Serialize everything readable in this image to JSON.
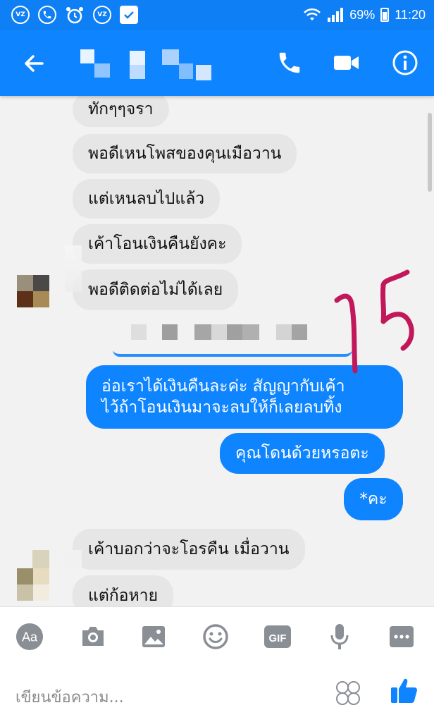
{
  "status_bar": {
    "battery": "69%",
    "time": "11:20",
    "icons": [
      "vpn-icon",
      "phone-icon",
      "alarm-icon",
      "vpn-icon",
      "clipboard-check-icon",
      "wifi-icon",
      "signal-icon",
      "battery-icon"
    ]
  },
  "header": {
    "contact_name_blurred": true,
    "actions": [
      "back-arrow-icon",
      "phone-call-icon",
      "video-call-icon",
      "info-icon"
    ]
  },
  "messages": [
    {
      "side": "in",
      "text": "ทักๆๆจรา"
    },
    {
      "side": "in",
      "text": "พอดีเหนโพสของคุนเมือวาน"
    },
    {
      "side": "in",
      "text": "แต่เหนลบไปแล้ว"
    },
    {
      "side": "in",
      "text": "เค้าโอนเงินคืนยังคะ"
    },
    {
      "side": "in",
      "text": "พอดีติดต่อไม่ได้เลย"
    },
    {
      "side": "out",
      "lines": [
        "อ่อเราได้เงินคืนละค่ะ สัญญากับเค้า",
        "ไว้ถ้าโอนเงินมาจะลบให้ก็เลยลบทิ้ง"
      ]
    },
    {
      "side": "out",
      "text": "คุณโดนด้วยหรอตะ"
    },
    {
      "side": "out",
      "text": "*คะ"
    },
    {
      "side": "in",
      "text": "เค้าบอกว่าจะโอรคืน เมื่อวาน"
    },
    {
      "side": "in",
      "text": "แต่ก้อหาย"
    }
  ],
  "annotation": "15",
  "composer": {
    "placeholder": "เขียนข้อความ...",
    "tools": [
      "text-aa-icon",
      "camera-icon",
      "image-icon",
      "smiley-icon",
      "gif-icon",
      "microphone-icon",
      "more-icon"
    ],
    "gif_label": "GIF",
    "aa_label": "Aa"
  },
  "colors": {
    "brand_blue": "#0f84ff",
    "incoming_bubble": "#e6e6e6",
    "annotation_ink": "#c2185b"
  }
}
